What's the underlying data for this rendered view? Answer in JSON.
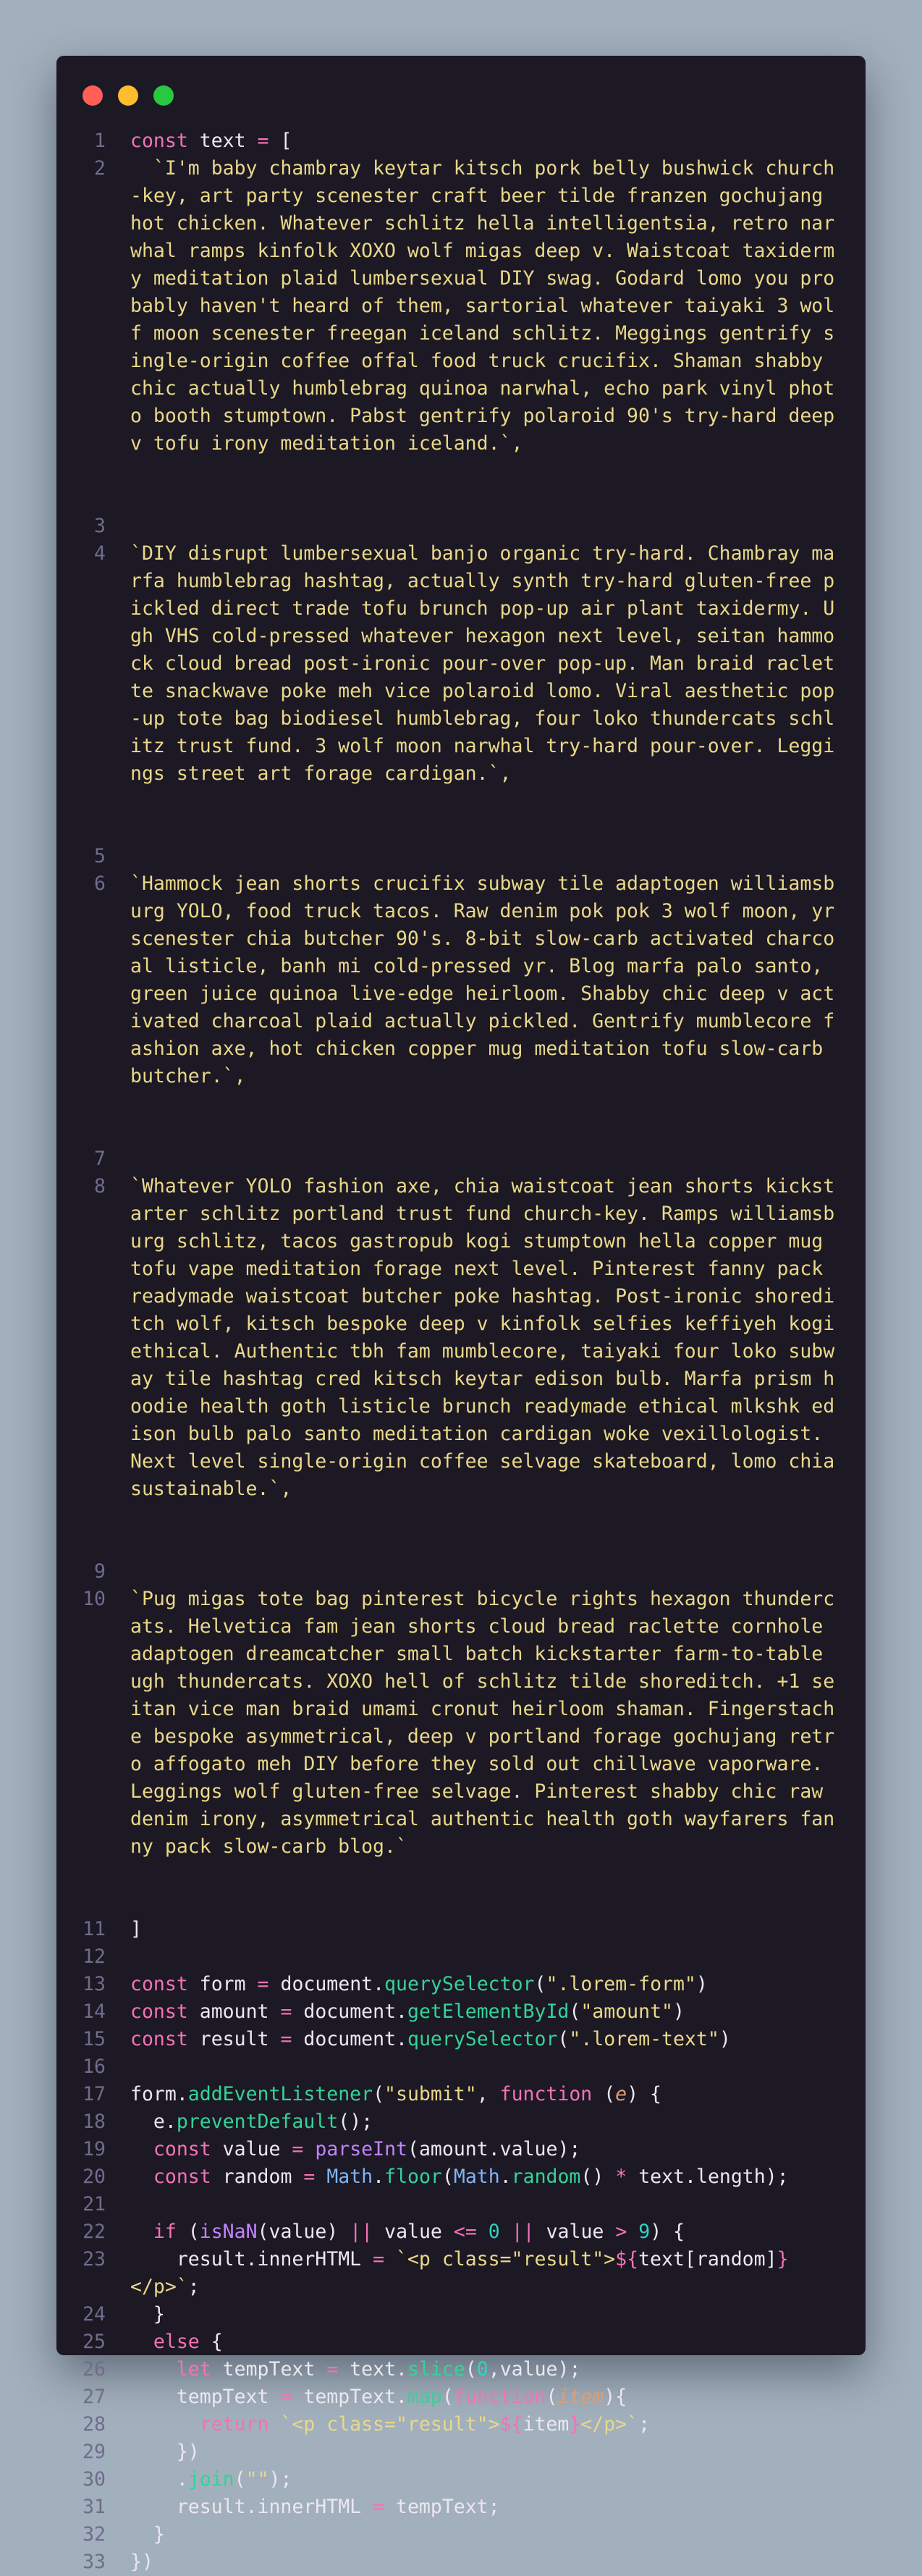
{
  "colors": {
    "page_background": "#a2afbc",
    "editor_background": "#1c1824",
    "line_number": "#6f6c8c",
    "keyword": "#f472b6",
    "function": "#34d399",
    "string": "#e9d889",
    "number": "#2dd4bf",
    "builtin": "#7fb5f5",
    "parameter": "#e49c6e",
    "plain": "#ece7f1"
  },
  "window_controls": [
    "close",
    "minimize",
    "maximize"
  ],
  "code": {
    "kw_const": "const",
    "kw_let": "let",
    "kw_function": "function",
    "kw_if": "if",
    "kw_else": "else",
    "kw_return": "return",
    "var_text": "text",
    "var_form": "form",
    "var_amount": "amount",
    "var_result": "result",
    "var_value": "value",
    "var_random": "random",
    "var_tempText": "tempText",
    "obj_document": "document",
    "obj_Math": "Math",
    "m_querySelector": "querySelector",
    "m_getElementById": "getElementById",
    "m_addEventListener": "addEventListener",
    "m_preventDefault": "preventDefault",
    "m_parseInt": "parseInt",
    "m_floor": "floor",
    "m_random": "random",
    "m_isNaN": "isNaN",
    "m_slice": "slice",
    "m_map": "map",
    "m_join": "join",
    "p_e": "e",
    "p_item": "item",
    "s_loremForm": "\".lorem-form\"",
    "s_amount": "\"amount\"",
    "s_loremText": "\".lorem-text\"",
    "s_submit": "\"submit\"",
    "s_empty": "\"\"",
    "t_open_p": "`<p class=\"result\">",
    "t_close_p": "</p>`",
    "t_open_expr": "${",
    "t_close_expr": "}",
    "n0": "0",
    "n9": "9",
    "paragraphs": [
      "  `I'm baby chambray keytar kitsch pork belly bushwick church-key, art party scenester craft beer tilde franzen gochujang hot chicken. Whatever schlitz hella intelligentsia, retro narwhal ramps kinfolk XOXO wolf migas deep v. Waistcoat taxidermy meditation plaid lumbersexual DIY swag. Godard lomo you probably haven't heard of them, sartorial whatever taiyaki 3 wolf moon scenester freegan iceland schlitz. Meggings gentrify single-origin coffee offal food truck crucifix. Shaman shabby chic actually humblebrag quinoa narwhal, echo park vinyl photo booth stumptown. Pabst gentrify polaroid 90's try-hard deep v tofu irony meditation iceland.`,",
      "`DIY disrupt lumbersexual banjo organic try-hard. Chambray marfa humblebrag hashtag, actually synth try-hard gluten-free pickled direct trade tofu brunch pop-up air plant taxidermy. Ugh VHS cold-pressed whatever hexagon next level, seitan hammock cloud bread post-ironic pour-over pop-up. Man braid raclette snackwave poke meh vice polaroid lomo. Viral aesthetic pop-up tote bag biodiesel humblebrag, four loko thundercats schlitz trust fund. 3 wolf moon narwhal try-hard pour-over. Leggings street art forage cardigan.`,",
      "`Hammock jean shorts crucifix subway tile adaptogen williamsburg YOLO, food truck tacos. Raw denim pok pok 3 wolf moon, yr scenester chia butcher 90's. 8-bit slow-carb activated charcoal listicle, banh mi cold-pressed yr. Blog marfa palo santo, green juice quinoa live-edge heirloom. Shabby chic deep v activated charcoal plaid actually pickled. Gentrify mumblecore fashion axe, hot chicken copper mug meditation tofu slow-carb butcher.`,",
      "`Whatever YOLO fashion axe, chia waistcoat jean shorts kickstarter schlitz portland trust fund church-key. Ramps williamsburg schlitz, tacos gastropub kogi stumptown hella copper mug tofu vape meditation forage next level. Pinterest fanny pack readymade waistcoat butcher poke hashtag. Post-ironic shoreditch wolf, kitsch bespoke deep v kinfolk selfies keffiyeh kogi ethical. Authentic tbh fam mumblecore, taiyaki four loko subway tile hashtag cred kitsch keytar edison bulb. Marfa prism hoodie health goth listicle brunch readymade ethical mlkshk edison bulb palo santo meditation cardigan woke vexillologist. Next level single-origin coffee selvage skateboard, lomo chia sustainable.`,",
      "`Pug migas tote bag pinterest bicycle rights hexagon thundercats. Helvetica fam jean shorts cloud bread raclette cornhole adaptogen dreamcatcher small batch kickstarter farm-to-table ugh thundercats. XOXO hell of schlitz tilde shoreditch. +1 seitan vice man braid umami cronut heirloom shaman. Fingerstache bespoke asymmetrical, deep v portland forage gochujang retro affogato meh DIY before they sold out chillwave vaporware. Leggings wolf gluten-free selvage. Pinterest shabby chic raw denim irony, asymmetrical authentic health goth wayfarers fanny pack slow-carb blog.`"
    ]
  }
}
